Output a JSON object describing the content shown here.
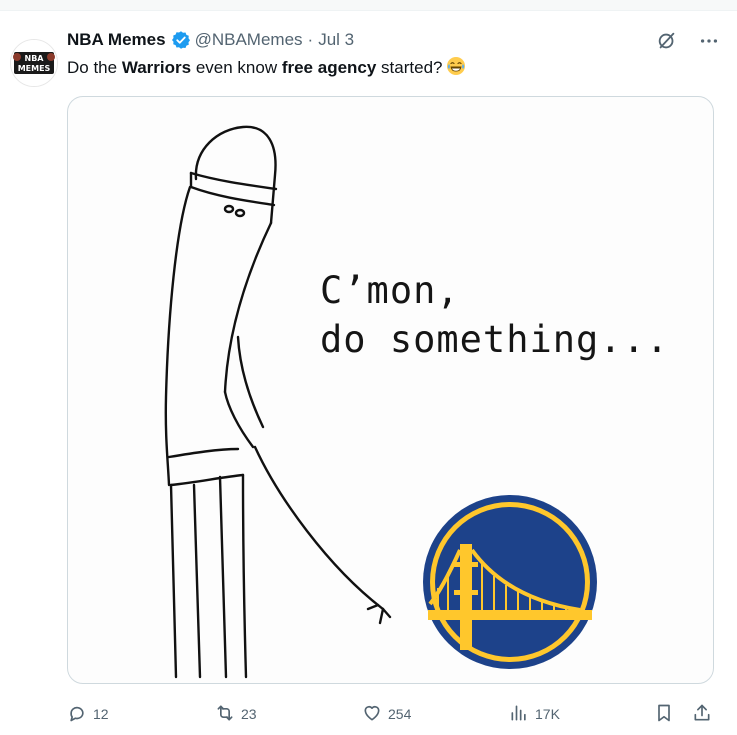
{
  "tweet": {
    "display_name": "NBA Memes",
    "handle": "@NBAMemes",
    "separator": "·",
    "date": "Jul 3",
    "avatar_text_top": "NBA",
    "avatar_text_bottom": "MEMES",
    "text_parts": [
      "Do the ",
      "Warriors",
      " even know ",
      "free agency",
      " started?"
    ],
    "emoji": "face-with-tears-of-joy",
    "media": {
      "caption_line1": "C’mon,",
      "caption_line2": "do something..."
    },
    "stats": {
      "replies": "12",
      "reposts": "23",
      "likes": "254",
      "views": "17K"
    }
  },
  "colors": {
    "warriors_blue": "#1d428a",
    "warriors_gold": "#ffc72c",
    "verified_blue": "#1d9bf0",
    "muted": "#536471"
  }
}
